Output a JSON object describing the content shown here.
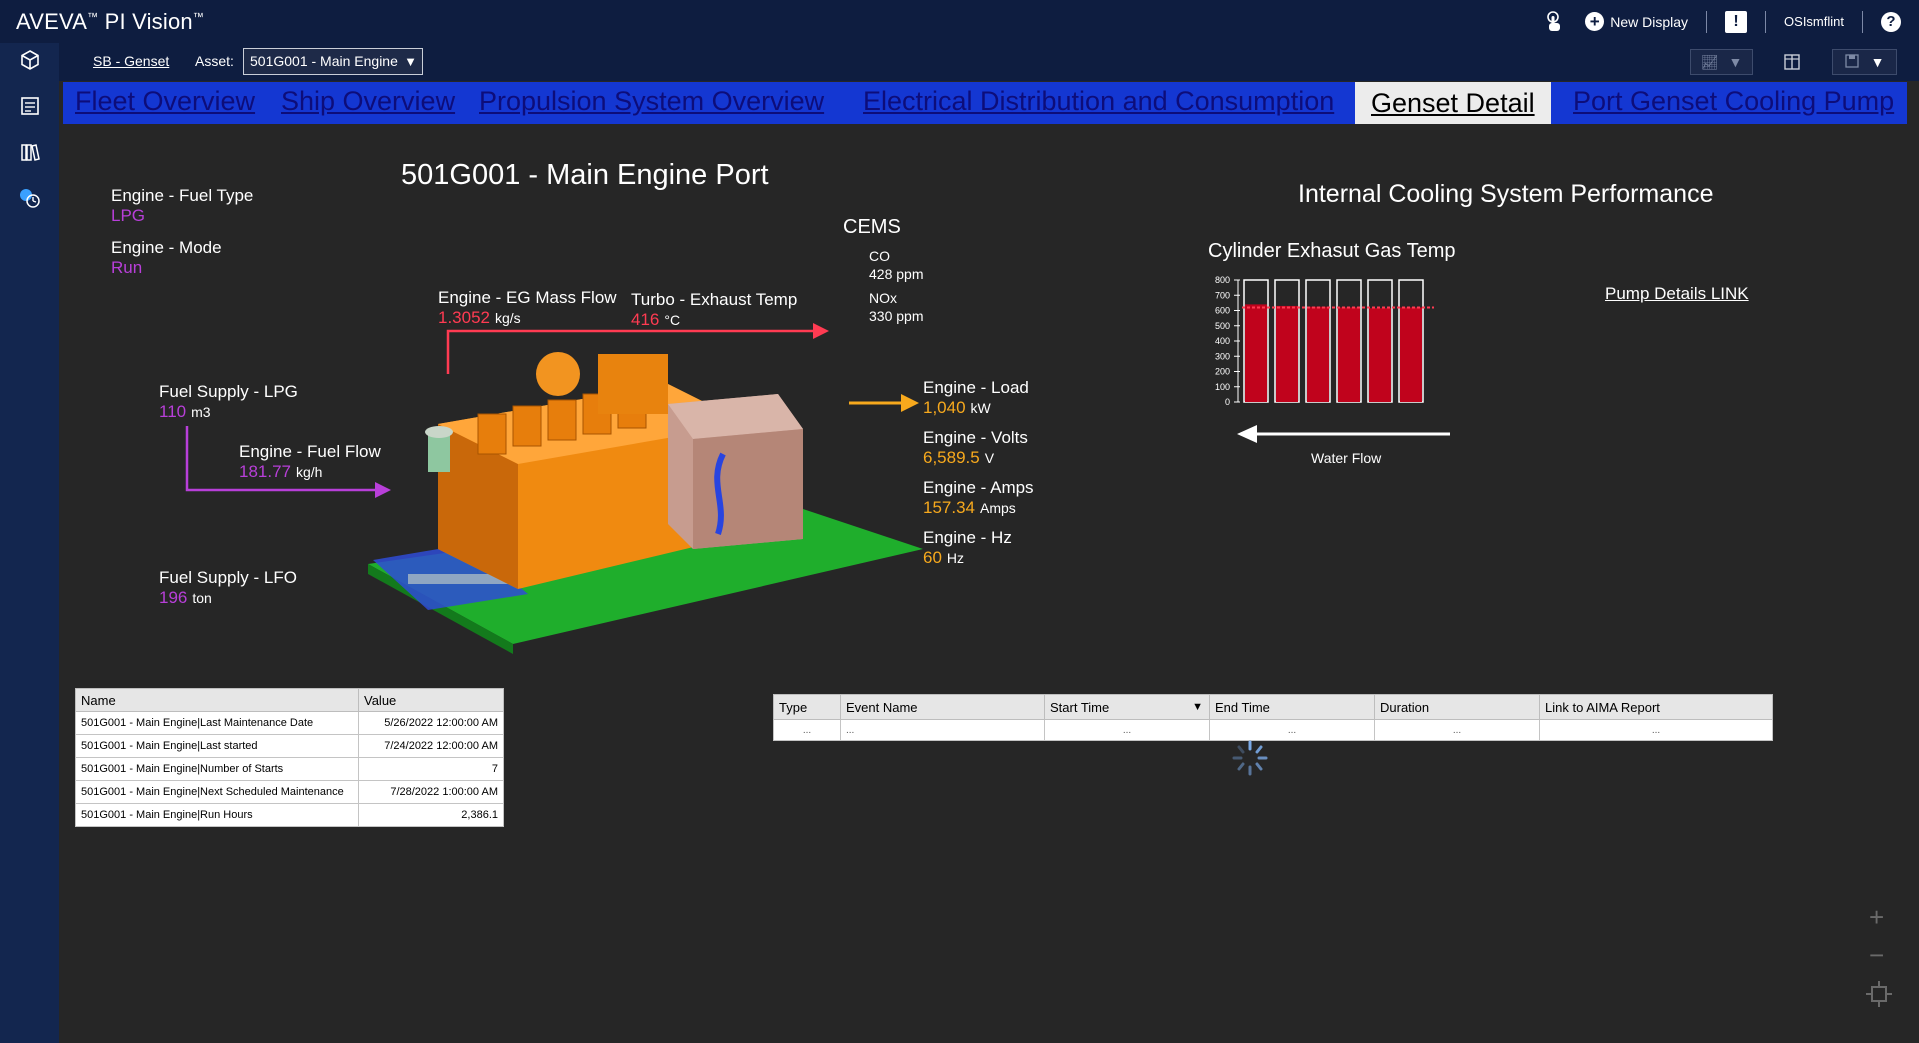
{
  "app": {
    "brand": "AVEVA",
    "product": "PI Vision"
  },
  "topbar": {
    "new_display": "New Display",
    "user": "OSIsmflint",
    "help": "?"
  },
  "subbar": {
    "breadcrumb": "SB - Genset",
    "asset_label": "Asset:",
    "asset_value": "501G001 - Main Engine"
  },
  "nav_tabs": [
    {
      "label": "Fleet Overview"
    },
    {
      "label": "Ship Overview"
    },
    {
      "label": "Propulsion System Overview"
    },
    {
      "label": "Electrical Distribution and Consumption"
    },
    {
      "label": "Genset Detail"
    },
    {
      "label": "Port Genset Cooling Pump"
    }
  ],
  "colors": {
    "purple": "#b83fd9",
    "red": "#ff3b52",
    "orange": "#f7a91d",
    "nav_bg": "#1437d2",
    "header_bg": "#0e1d40"
  },
  "main": {
    "title": "501G001 - Main Engine  Port",
    "fuel_type": {
      "label": "Engine - Fuel Type",
      "value": "LPG"
    },
    "mode": {
      "label": "Engine - Mode",
      "value": "Run"
    },
    "cems": {
      "title": "CEMS",
      "co_label": "CO",
      "co_value": "428 ppm",
      "nox_label": "NOx",
      "nox_value": "330 ppm"
    },
    "eg_mass_flow": {
      "label": "Engine - EG Mass Flow",
      "value": "1.3052",
      "unit": "kg/s"
    },
    "turbo_temp": {
      "label": "Turbo - Exhaust Temp",
      "value": "416",
      "unit": "°C"
    },
    "fuel_supply_lpg": {
      "label": "Fuel Supply - LPG",
      "value": "110",
      "unit": "m3"
    },
    "fuel_flow": {
      "label": "Engine - Fuel Flow",
      "value": "181.77",
      "unit": "kg/h"
    },
    "fuel_supply_lfo": {
      "label": "Fuel Supply - LFO",
      "value": "196",
      "unit": "ton"
    },
    "load": {
      "label": "Engine - Load",
      "value": "1,040",
      "unit": "kW"
    },
    "volts": {
      "label": "Engine - Volts",
      "value": "6,589.5",
      "unit": "V"
    },
    "amps": {
      "label": "Engine - Amps",
      "value": "157.34",
      "unit": "Amps"
    },
    "hz": {
      "label": "Engine - Hz",
      "value": "60",
      "unit": "Hz"
    },
    "cooling_title": "Internal Cooling System Performance",
    "cylinder_title": "Cylinder Exhasut Gas Temp",
    "water_flow": "Water Flow",
    "pump_link": "Pump Details LINK"
  },
  "chart_data": {
    "type": "bar",
    "title": "Cylinder Exhasut Gas Temp",
    "xlabel": "Water Flow",
    "ylabel": "",
    "ylim": [
      0,
      800
    ],
    "yticks": [
      "0",
      "100",
      "200",
      "300",
      "400",
      "500",
      "600",
      "700",
      "800"
    ],
    "values": [
      640,
      630,
      625,
      620,
      615,
      620
    ],
    "limit_line": 620
  },
  "attributes_table": {
    "headers": [
      "Name",
      "Value"
    ],
    "rows": [
      [
        "501G001 - Main Engine|Last Maintenance Date",
        "5/26/2022 12:00:00 AM"
      ],
      [
        "501G001 - Main Engine|Last started",
        "7/24/2022 12:00:00 AM"
      ],
      [
        "501G001 - Main Engine|Number of Starts",
        "7"
      ],
      [
        "501G001 - Main Engine|Next Scheduled Maintenance",
        "7/28/2022 1:00:00 AM"
      ],
      [
        "501G001 - Main Engine|Run Hours",
        "2,386.1"
      ]
    ]
  },
  "events_table": {
    "headers": [
      "Type",
      "Event Name",
      "Start Time",
      "End Time",
      "Duration",
      "Link to AIMA Report"
    ],
    "row": [
      "...",
      "...",
      "...",
      "...",
      "...",
      "..."
    ]
  }
}
